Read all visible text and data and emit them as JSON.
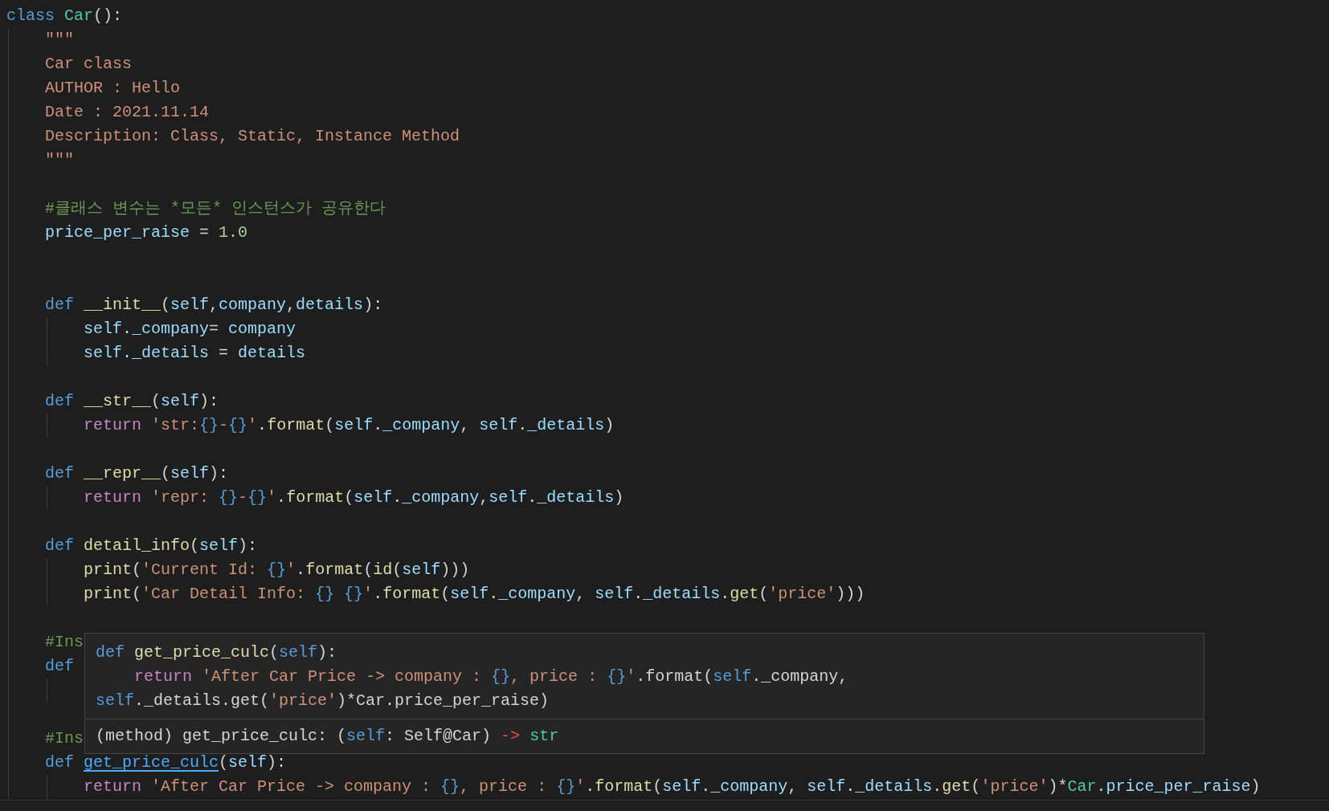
{
  "editor": {
    "lines": [
      {
        "kind": "code",
        "tokens": [
          {
            "text": "class ",
            "kind": "keyword"
          },
          {
            "text": "Car",
            "kind": "type"
          },
          {
            "text": "():",
            "kind": "plain"
          }
        ]
      },
      {
        "kind": "code",
        "tokens": [
          {
            "text": "    \"\"\"",
            "kind": "string"
          }
        ]
      },
      {
        "kind": "code",
        "tokens": [
          {
            "text": "    Car class",
            "kind": "string"
          }
        ]
      },
      {
        "kind": "code",
        "tokens": [
          {
            "text": "    AUTHOR : Hello",
            "kind": "string"
          }
        ]
      },
      {
        "kind": "code",
        "tokens": [
          {
            "text": "    Date : 2021.11.14",
            "kind": "string"
          }
        ]
      },
      {
        "kind": "code",
        "tokens": [
          {
            "text": "    Description: Class, Static, Instance Method",
            "kind": "string"
          }
        ]
      },
      {
        "kind": "code",
        "tokens": [
          {
            "text": "    \"\"\"",
            "kind": "string"
          }
        ]
      },
      {
        "kind": "blank"
      },
      {
        "kind": "code",
        "tokens": [
          {
            "text": "    #클래스 변수는 *모든* 인스턴스가 공유한다",
            "kind": "comment"
          }
        ]
      },
      {
        "kind": "code",
        "tokens": [
          {
            "text": "    price_per_raise",
            "kind": "variable"
          },
          {
            "text": " = ",
            "kind": "plain"
          },
          {
            "text": "1.0",
            "kind": "number"
          }
        ]
      },
      {
        "kind": "blank"
      },
      {
        "kind": "blank"
      },
      {
        "kind": "code",
        "tokens": [
          {
            "text": "    def ",
            "kind": "keyword"
          },
          {
            "text": "__init__",
            "kind": "function"
          },
          {
            "text": "(",
            "kind": "plain"
          },
          {
            "text": "self",
            "kind": "variable"
          },
          {
            "text": ",",
            "kind": "plain"
          },
          {
            "text": "company",
            "kind": "variable"
          },
          {
            "text": ",",
            "kind": "plain"
          },
          {
            "text": "details",
            "kind": "variable"
          },
          {
            "text": "):",
            "kind": "plain"
          }
        ]
      },
      {
        "kind": "code",
        "tokens": [
          {
            "text": "        self",
            "kind": "variable"
          },
          {
            "text": ".",
            "kind": "plain"
          },
          {
            "text": "_company",
            "kind": "variable"
          },
          {
            "text": "= ",
            "kind": "plain"
          },
          {
            "text": "company",
            "kind": "variable"
          }
        ]
      },
      {
        "kind": "code",
        "tokens": [
          {
            "text": "        self",
            "kind": "variable"
          },
          {
            "text": ".",
            "kind": "plain"
          },
          {
            "text": "_details",
            "kind": "variable"
          },
          {
            "text": " = ",
            "kind": "plain"
          },
          {
            "text": "details",
            "kind": "variable"
          }
        ]
      },
      {
        "kind": "blank"
      },
      {
        "kind": "code",
        "tokens": [
          {
            "text": "    def ",
            "kind": "keyword"
          },
          {
            "text": "__str__",
            "kind": "function"
          },
          {
            "text": "(",
            "kind": "plain"
          },
          {
            "text": "self",
            "kind": "variable"
          },
          {
            "text": "):",
            "kind": "plain"
          }
        ]
      },
      {
        "kind": "code",
        "tokens": [
          {
            "text": "        return ",
            "kind": "control"
          },
          {
            "text": "'str:",
            "kind": "string"
          },
          {
            "text": "{}",
            "kind": "brace"
          },
          {
            "text": "-",
            "kind": "string"
          },
          {
            "text": "{}",
            "kind": "brace"
          },
          {
            "text": "'",
            "kind": "string"
          },
          {
            "text": ".",
            "kind": "plain"
          },
          {
            "text": "format",
            "kind": "function"
          },
          {
            "text": "(",
            "kind": "plain"
          },
          {
            "text": "self",
            "kind": "variable"
          },
          {
            "text": ".",
            "kind": "plain"
          },
          {
            "text": "_company",
            "kind": "variable"
          },
          {
            "text": ", ",
            "kind": "plain"
          },
          {
            "text": "self",
            "kind": "variable"
          },
          {
            "text": ".",
            "kind": "plain"
          },
          {
            "text": "_details",
            "kind": "variable"
          },
          {
            "text": ")",
            "kind": "plain"
          }
        ]
      },
      {
        "kind": "blank"
      },
      {
        "kind": "code",
        "tokens": [
          {
            "text": "    def ",
            "kind": "keyword"
          },
          {
            "text": "__repr__",
            "kind": "function"
          },
          {
            "text": "(",
            "kind": "plain"
          },
          {
            "text": "self",
            "kind": "variable"
          },
          {
            "text": "):",
            "kind": "plain"
          }
        ]
      },
      {
        "kind": "code",
        "tokens": [
          {
            "text": "        return ",
            "kind": "control"
          },
          {
            "text": "'repr: ",
            "kind": "string"
          },
          {
            "text": "{}",
            "kind": "brace"
          },
          {
            "text": "-",
            "kind": "string"
          },
          {
            "text": "{}",
            "kind": "brace"
          },
          {
            "text": "'",
            "kind": "string"
          },
          {
            "text": ".",
            "kind": "plain"
          },
          {
            "text": "format",
            "kind": "function"
          },
          {
            "text": "(",
            "kind": "plain"
          },
          {
            "text": "self",
            "kind": "variable"
          },
          {
            "text": ".",
            "kind": "plain"
          },
          {
            "text": "_company",
            "kind": "variable"
          },
          {
            "text": ",",
            "kind": "plain"
          },
          {
            "text": "self",
            "kind": "variable"
          },
          {
            "text": ".",
            "kind": "plain"
          },
          {
            "text": "_details",
            "kind": "variable"
          },
          {
            "text": ")",
            "kind": "plain"
          }
        ]
      },
      {
        "kind": "blank"
      },
      {
        "kind": "code",
        "tokens": [
          {
            "text": "    def ",
            "kind": "keyword"
          },
          {
            "text": "detail_info",
            "kind": "function"
          },
          {
            "text": "(",
            "kind": "plain"
          },
          {
            "text": "self",
            "kind": "variable"
          },
          {
            "text": "):",
            "kind": "plain"
          }
        ]
      },
      {
        "kind": "code",
        "tokens": [
          {
            "text": "        print",
            "kind": "function"
          },
          {
            "text": "(",
            "kind": "plain"
          },
          {
            "text": "'Current Id: ",
            "kind": "string"
          },
          {
            "text": "{}",
            "kind": "brace"
          },
          {
            "text": "'",
            "kind": "string"
          },
          {
            "text": ".",
            "kind": "plain"
          },
          {
            "text": "format",
            "kind": "function"
          },
          {
            "text": "(",
            "kind": "plain"
          },
          {
            "text": "id",
            "kind": "function"
          },
          {
            "text": "(",
            "kind": "plain"
          },
          {
            "text": "self",
            "kind": "variable"
          },
          {
            "text": ")))",
            "kind": "plain"
          }
        ]
      },
      {
        "kind": "code",
        "tokens": [
          {
            "text": "        print",
            "kind": "function"
          },
          {
            "text": "(",
            "kind": "plain"
          },
          {
            "text": "'Car Detail Info: ",
            "kind": "string"
          },
          {
            "text": "{} {}",
            "kind": "brace"
          },
          {
            "text": "'",
            "kind": "string"
          },
          {
            "text": ".",
            "kind": "plain"
          },
          {
            "text": "format",
            "kind": "function"
          },
          {
            "text": "(",
            "kind": "plain"
          },
          {
            "text": "self",
            "kind": "variable"
          },
          {
            "text": ".",
            "kind": "plain"
          },
          {
            "text": "_company",
            "kind": "variable"
          },
          {
            "text": ", ",
            "kind": "plain"
          },
          {
            "text": "self",
            "kind": "variable"
          },
          {
            "text": ".",
            "kind": "plain"
          },
          {
            "text": "_details",
            "kind": "variable"
          },
          {
            "text": ".",
            "kind": "plain"
          },
          {
            "text": "get",
            "kind": "function"
          },
          {
            "text": "(",
            "kind": "plain"
          },
          {
            "text": "'price'",
            "kind": "string"
          },
          {
            "text": ")))",
            "kind": "plain"
          }
        ]
      },
      {
        "kind": "blank"
      },
      {
        "kind": "code",
        "tokens": [
          {
            "text": "    #Ins",
            "kind": "comment"
          }
        ]
      },
      {
        "kind": "code",
        "tokens": [
          {
            "text": "    def",
            "kind": "keyword"
          }
        ]
      },
      {
        "kind": "covered"
      },
      {
        "kind": "blank"
      },
      {
        "kind": "code",
        "tokens": [
          {
            "text": "    #Ins",
            "kind": "comment"
          }
        ]
      },
      {
        "kind": "code",
        "tokens": [
          {
            "text": "    def ",
            "kind": "keyword"
          },
          {
            "text": "get_price_culc",
            "kind": "link"
          },
          {
            "text": "(",
            "kind": "plain"
          },
          {
            "text": "self",
            "kind": "variable"
          },
          {
            "text": "):",
            "kind": "plain"
          }
        ]
      },
      {
        "kind": "code",
        "tokens": [
          {
            "text": "        return ",
            "kind": "control"
          },
          {
            "text": "'After Car Price -> company : ",
            "kind": "string"
          },
          {
            "text": "{}",
            "kind": "brace"
          },
          {
            "text": ", price : ",
            "kind": "string"
          },
          {
            "text": "{}",
            "kind": "brace"
          },
          {
            "text": "'",
            "kind": "string"
          },
          {
            "text": ".",
            "kind": "plain"
          },
          {
            "text": "format",
            "kind": "function"
          },
          {
            "text": "(",
            "kind": "plain"
          },
          {
            "text": "self",
            "kind": "variable"
          },
          {
            "text": ".",
            "kind": "plain"
          },
          {
            "text": "_company",
            "kind": "variable"
          },
          {
            "text": ", ",
            "kind": "plain"
          },
          {
            "text": "self",
            "kind": "variable"
          },
          {
            "text": ".",
            "kind": "plain"
          },
          {
            "text": "_details",
            "kind": "variable"
          },
          {
            "text": ".",
            "kind": "plain"
          },
          {
            "text": "get",
            "kind": "function"
          },
          {
            "text": "(",
            "kind": "plain"
          },
          {
            "text": "'price'",
            "kind": "string"
          },
          {
            "text": ")*",
            "kind": "plain"
          },
          {
            "text": "Car",
            "kind": "type"
          },
          {
            "text": ".",
            "kind": "plain"
          },
          {
            "text": "price_per_raise",
            "kind": "variable"
          },
          {
            "text": ")",
            "kind": "plain"
          }
        ]
      }
    ]
  },
  "hover_popup": {
    "code_lines": [
      {
        "tokens": [
          {
            "text": "def ",
            "kind": "keyword"
          },
          {
            "text": "get_price_culc",
            "kind": "function"
          },
          {
            "text": "(",
            "kind": "plain"
          },
          {
            "text": "self",
            "kind": "keyword"
          },
          {
            "text": "):",
            "kind": "plain"
          }
        ]
      },
      {
        "tokens": [
          {
            "text": "    return ",
            "kind": "control"
          },
          {
            "text": "'After Car Price -> company : ",
            "kind": "string"
          },
          {
            "text": "{}",
            "kind": "brace"
          },
          {
            "text": ", price : ",
            "kind": "string"
          },
          {
            "text": "{}",
            "kind": "brace"
          },
          {
            "text": "'",
            "kind": "string"
          },
          {
            "text": ".format(",
            "kind": "plain"
          },
          {
            "text": "self",
            "kind": "keyword"
          },
          {
            "text": "._company,",
            "kind": "plain"
          }
        ]
      },
      {
        "tokens": [
          {
            "text": "self",
            "kind": "keyword"
          },
          {
            "text": "._details.get(",
            "kind": "plain"
          },
          {
            "text": "'price'",
            "kind": "string"
          },
          {
            "text": ")*Car.price_per_raise)",
            "kind": "plain"
          }
        ]
      }
    ],
    "signature": {
      "tokens": [
        {
          "text": "(method) get_price_culc: (",
          "kind": "plain"
        },
        {
          "text": "self",
          "kind": "keyword"
        },
        {
          "text": ": Self@Car) ",
          "kind": "plain"
        },
        {
          "text": "-> ",
          "kind": "arrow"
        },
        {
          "text": "str",
          "kind": "type"
        }
      ]
    }
  }
}
